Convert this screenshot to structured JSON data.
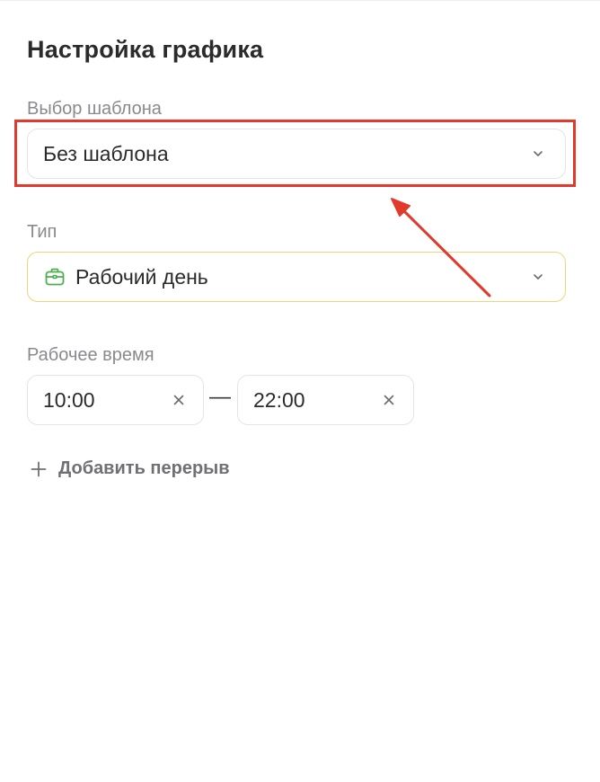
{
  "page": {
    "title": "Настройка графика"
  },
  "template": {
    "label": "Выбор шаблона",
    "selected": "Без шаблона",
    "icon": "chevron-down-icon"
  },
  "type": {
    "label": "Тип",
    "selected": "Рабочий день",
    "icon": "briefcase-icon",
    "icon_color": "#4caf50",
    "border_color": "#efd57a"
  },
  "working_time": {
    "label": "Рабочее время",
    "start": "10:00",
    "end": "22:00",
    "separator": "—",
    "clear_icon": "close-icon"
  },
  "add_break": {
    "label": "Добавить перерыв",
    "icon": "plus-icon"
  },
  "annotation": {
    "highlight_color": "#e1392b"
  }
}
